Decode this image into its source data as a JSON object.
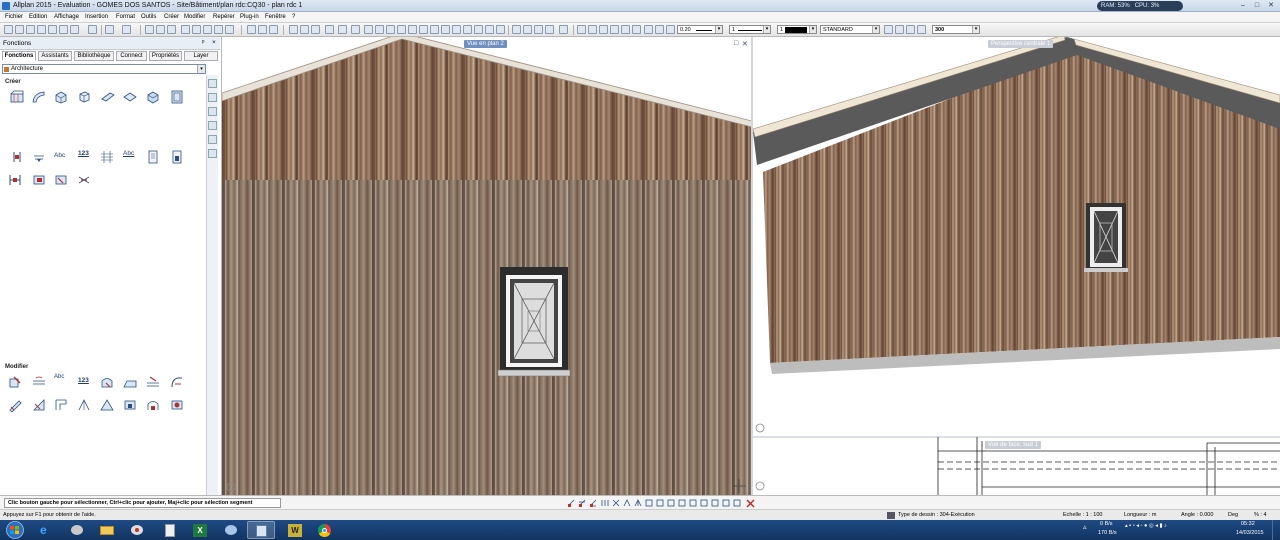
{
  "window": {
    "title": "Allplan 2015 - Evaluation - GOMES DOS SANTOS - Site/Bâtiment/plan rdc:CQ30 - plan rdc 1",
    "ram": "RAM: 53%",
    "cpu": "CPU: 3%"
  },
  "menu": [
    "Fichier",
    "Edition",
    "Affichage",
    "Insertion",
    "Format",
    "Outils",
    "Créer",
    "Modifier",
    "Repérer",
    "Plug-in",
    "Fenêtre",
    "?"
  ],
  "toolbar": {
    "pen": "0.20",
    "line": "1",
    "color": "1",
    "layer": "STANDARD",
    "scale_value": "300"
  },
  "left_panel": {
    "title": "Fonctions",
    "pin": "ᵖ",
    "close": "×",
    "tabs": [
      "Fonctions",
      "Assistants",
      "Bibliothèque",
      "Connect",
      "Propriétés",
      "Layer"
    ],
    "module": "Architecture",
    "create_label": "Créer",
    "modify_label": "Modifier",
    "create_text_icons": [
      "Abc",
      "123",
      "Abc"
    ],
    "modify_text_icons": [
      "Abc",
      "123"
    ]
  },
  "viewports": {
    "left_label": "Vue en plan 2",
    "right_top_label": "Perspective centrale 1",
    "right_bottom_label": "Vue de face, sud 1"
  },
  "status": {
    "hint": "Clic bouton gauche pour sélectionner, Ctrl+clic pour ajouter, Maj+clic pour sélection segment"
  },
  "infobar": {
    "help": "Appuyez sur F1 pour obtenir de l'aide.",
    "drawing_type": "Type de dessin : 304-Exécution",
    "scale": "Echelle : 1 : 100",
    "length": "Longueur : m",
    "angle": "Angle : 0.000",
    "deg": "Deg",
    "percent": "% : 4"
  },
  "tray": {
    "net_up": "0 B/s",
    "net_down": "170 B/s",
    "time": "05:32",
    "date": "14/03/2015"
  },
  "colors": {
    "accent": "#6f8fc0",
    "taskbar": "#1e4a83"
  }
}
